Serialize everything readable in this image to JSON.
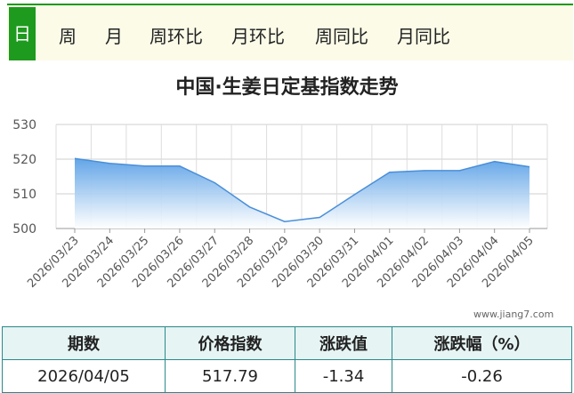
{
  "tabs": [
    {
      "label": "日",
      "active": true
    },
    {
      "label": "周",
      "active": false
    },
    {
      "label": "月",
      "active": false
    },
    {
      "label": "周环比",
      "active": false
    },
    {
      "label": "月环比",
      "active": false
    },
    {
      "label": "周同比",
      "active": false
    },
    {
      "label": "月同比",
      "active": false
    }
  ],
  "watermark": "www.jiang7.com",
  "colors": {
    "accent": "#1e9a1e",
    "area_top": "#5aa0e6",
    "line": "#4a8fd8",
    "table_border": "#2a8a8a"
  },
  "chart_data": {
    "type": "area",
    "title": "中国·生姜日定基指数走势",
    "xlabel": "",
    "ylabel": "",
    "ylim": [
      500,
      530
    ],
    "yticks": [
      500,
      510,
      520,
      530
    ],
    "grid": true,
    "categories": [
      "2026/03/23",
      "2026/03/24",
      "2026/03/25",
      "2026/03/26",
      "2026/03/27",
      "2026/03/28",
      "2026/03/29",
      "2026/03/30",
      "2026/03/31",
      "2026/04/01",
      "2026/04/02",
      "2026/04/03",
      "2026/04/04",
      "2026/04/05"
    ],
    "series": [
      {
        "values": [
          520.2,
          518.8,
          518.0,
          518.0,
          513.2,
          506.2,
          502.0,
          503.2,
          509.8,
          516.2,
          516.7,
          516.7,
          519.3,
          517.79
        ]
      }
    ]
  },
  "summary": {
    "headers": [
      "期数",
      "价格指数",
      "涨跌值",
      "涨跌幅（%）"
    ],
    "row": [
      "2026/04/05",
      "517.79",
      "-1.34",
      "-0.26"
    ]
  }
}
